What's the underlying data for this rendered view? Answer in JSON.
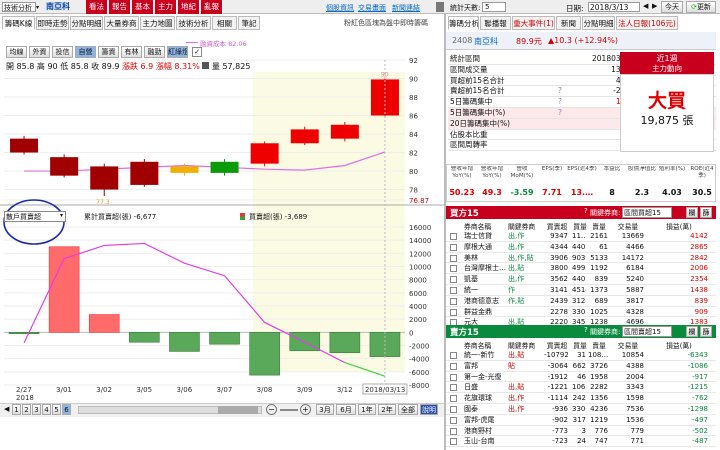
{
  "toolbar": {
    "mode": "技術分析",
    "count": "5",
    "stock_code": "2408",
    "stock_name": "南亞科",
    "tabs": [
      "看法",
      "報告",
      "基本",
      "主力",
      "地紀",
      "亂報"
    ],
    "links": [
      "個股資訊",
      "交易畫面",
      "新聞連結"
    ],
    "date_label": "日期:",
    "date_value": "2018/3/13",
    "today_label": "今天",
    "refresh_label": "更新"
  },
  "main_tabs": [
    "籌碼K線",
    "即時走勢",
    "分點明細",
    "大量券商",
    "主力地圖",
    "技術分析",
    "相關",
    "筆記"
  ],
  "notice": "粉紅色區塊為盤中即時籌碼",
  "kline": {
    "mode_buttons": [
      "均線",
      "外資",
      "投信",
      "自營",
      "籌資",
      "有林",
      "融勁",
      "紅綠燈"
    ],
    "toggle": "✓",
    "legend_cost": "融資成本 82.06",
    "ohlc": {
      "open_label": "開",
      "open": "85.8",
      "high_label": "高",
      "high": "90",
      "low_label": "低",
      "low": "85.8",
      "close_label": "收",
      "close": "89.9",
      "chg_label": "漲跌",
      "chg": "6.9",
      "pct_label": "漲幅",
      "pct": "8.31%",
      "vol_label": "量",
      "vol": "57,825"
    },
    "price_axis": [
      "92",
      "90",
      "88",
      "86",
      "84",
      "82",
      "80",
      "78",
      "76.87"
    ],
    "max_label": "90",
    "min_label": "77.3"
  },
  "chip": {
    "dropdown": "散戶買賣超",
    "legend1": "累計買賣超(張) -6,677",
    "legend2": "買賣超(張) -3,689",
    "axis": [
      "16000",
      "14000",
      "12000",
      "10000",
      "8000",
      "6000",
      "4000",
      "2000",
      "0",
      "-2000",
      "-4000",
      "-6000",
      "-8000"
    ]
  },
  "chart_data": {
    "type": "bar",
    "title": "散戶買賣超",
    "categories": [
      "2/27",
      "3/01",
      "3/02",
      "3/05",
      "3/06",
      "3/07",
      "3/08",
      "3/09",
      "3/12",
      "3/13"
    ],
    "kline": {
      "open": [
        83.5,
        81.5,
        80.5,
        81,
        79.8,
        79.8,
        80.8,
        83,
        83.5,
        86
      ],
      "close": [
        82,
        79.5,
        78,
        78.5,
        80.5,
        81,
        83,
        84.5,
        85,
        89.9
      ],
      "high": [
        83.8,
        81.8,
        80.8,
        81.3,
        80.8,
        81.3,
        83.2,
        84.8,
        85.3,
        90
      ],
      "low": [
        81.8,
        79.3,
        77.3,
        78.3,
        79.5,
        79.5,
        80.5,
        82.8,
        83.2,
        85.8
      ]
    },
    "net_buy": [
      -200,
      13000,
      2700,
      -1500,
      -2900,
      -1800,
      -6500,
      -2800,
      -3100,
      -3689
    ],
    "cumulative": [
      -1600,
      11200,
      13200,
      13500,
      10500,
      8600,
      1500,
      -1500,
      -4600,
      -6677
    ],
    "chip_ylim": [
      -8000,
      16000
    ],
    "price_ylim": [
      76.87,
      92
    ]
  },
  "x_axis": {
    "year": "2018",
    "dates": [
      "2/27",
      "3/01",
      "3/02",
      "3/05",
      "3/06",
      "3/07",
      "3/08",
      "3/09",
      "3/12"
    ],
    "cursor_date": "2018/03/13"
  },
  "nav": {
    "pages": [
      "1",
      "2",
      "3",
      "4",
      "5",
      "6"
    ],
    "ranges": [
      "3月",
      "6月",
      "1年",
      "2年",
      "全部",
      "說明"
    ]
  },
  "right_tabs": [
    "籌碼分析",
    "聯播報",
    "重大事件(1)",
    "新聞",
    "分點明細",
    "法人日報(106元)"
  ],
  "summary": {
    "stock_code": "2408",
    "stock_name": "南亞科",
    "price": "89.9元",
    "change": "▲10.3 (+12.94%)",
    "rows": [
      {
        "label": "統計區間",
        "value": "20180307 ~ 201803"
      },
      {
        "label": "區間成交量",
        "value": "134,597 張"
      },
      {
        "label": "買超前15名合計",
        "value": "43,852 張"
      },
      {
        "label": "賣超前15名合計",
        "value": "-23,977 張"
      },
      {
        "label": "5日籌碼集中",
        "value": "19,875 張"
      },
      {
        "label": "5日籌碼集中(%)",
        "value": "14.77 %"
      },
      {
        "label": "20日籌碼集中(%)",
        "value": "6.22 %"
      },
      {
        "label": "佔股本比重",
        "value": "0.67 %"
      },
      {
        "label": "區間周轉率",
        "value": "4.54 %"
      }
    ],
    "period_label": "近1週",
    "period_sub": "主力動向",
    "verdict": "大買",
    "verdict_amount": "19,875 張"
  },
  "metrics": {
    "headers": [
      "營收年增YoY(%)",
      "營收年增YoY(%)",
      "營收MoM(%)",
      "EPS(季)",
      "EPS(近4季)",
      "本益比",
      "股價淨值比",
      "殖利率(%)",
      "ROE(近4季)"
    ],
    "values": [
      "50.23",
      "49.3",
      "-3.59",
      "7.71",
      "13.…",
      "8",
      "2.3",
      "4.03",
      "30.5"
    ]
  },
  "buy": {
    "title": "買方15",
    "filter_label": "關鍵券商:",
    "filter_value": "區間買超15",
    "btn1": "欄",
    "btn2": "篩",
    "headers": [
      "券商名稱",
      "關鍵券商",
      "買賣超",
      "買量",
      "賣量",
      "交易量",
      "損益(萬)"
    ],
    "rows": [
      [
        "瑞士信貸",
        "出,作",
        "9347",
        "11…",
        "2161",
        "13669",
        "4142"
      ],
      [
        "摩根大通",
        "出,作",
        "4344",
        "4405",
        "61",
        "4466",
        "2865"
      ],
      [
        "美林",
        "出,作,貼",
        "3906",
        "9039",
        "5133",
        "14172",
        "2842"
      ],
      [
        "台灣摩根士…",
        "出,貼",
        "3800",
        "4992",
        "1192",
        "6184",
        "2006"
      ],
      [
        "凱基",
        "出,作",
        "3562",
        "4401",
        "839",
        "5240",
        "2354"
      ],
      [
        "統一",
        "作",
        "3141",
        "4514",
        "1373",
        "5887",
        "1438"
      ],
      [
        "港商德意志",
        "作,貼",
        "2439",
        "3128",
        "689",
        "3817",
        "839"
      ],
      [
        "群益金鼎",
        "",
        "2278",
        "3303",
        "1025",
        "4328",
        "909"
      ],
      [
        "元大",
        "出,貼",
        "2220",
        "3458",
        "1238",
        "4696",
        "1383"
      ]
    ]
  },
  "sell": {
    "title": "賣方15",
    "filter_label": "關鍵券商:",
    "filter_value": "區間賣超15",
    "btn1": "欄",
    "btn2": "篩",
    "headers": [
      "券商名稱",
      "關鍵券商",
      "買賣超",
      "買量",
      "賣量",
      "交易量",
      "損益(萬)"
    ],
    "rows": [
      [
        "統一-新竹",
        "出,貼",
        "-10792",
        "31",
        "108…",
        "10854",
        "-6343"
      ],
      [
        "富邦",
        "貼",
        "-3064",
        "662",
        "3726",
        "4388",
        "-1086"
      ],
      [
        "第一金-光復",
        "",
        "-1912",
        "46",
        "1958",
        "2004",
        "-917"
      ],
      [
        "日盛",
        "出,貼",
        "-1221",
        "1061",
        "2282",
        "3343",
        "-1215"
      ],
      [
        "花旗環球",
        "出,作",
        "-1114",
        "242",
        "1356",
        "1598",
        "-762"
      ],
      [
        "國泰",
        "出,作",
        "-936",
        "3300",
        "4236",
        "7536",
        "-1298"
      ],
      [
        "富邦-虎尾",
        "",
        "-902",
        "317",
        "1219",
        "1536",
        "-497"
      ],
      [
        "港商野村",
        "",
        "-773",
        "3",
        "776",
        "779",
        "-502"
      ],
      [
        "玉山-台南",
        "",
        "-723",
        "24",
        "747",
        "771",
        "-487"
      ]
    ]
  }
}
